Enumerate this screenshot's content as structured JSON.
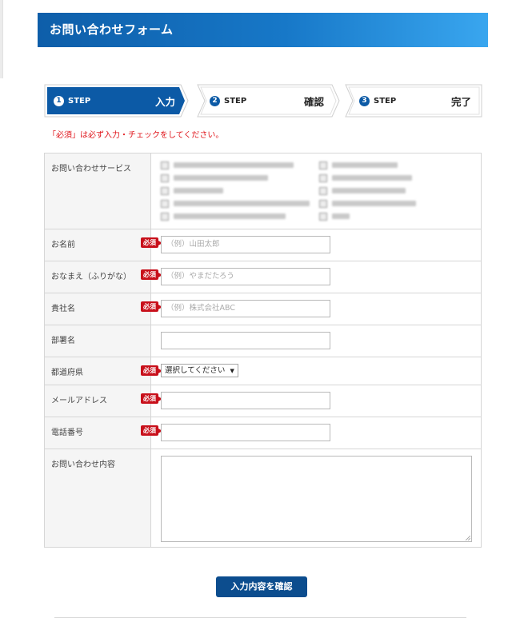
{
  "header": {
    "title": "お問い合わせフォーム"
  },
  "steps": [
    {
      "number": "1",
      "label": "STEP",
      "title": "入力",
      "active": true
    },
    {
      "number": "2",
      "label": "STEP",
      "title": "確認",
      "active": false
    },
    {
      "number": "3",
      "label": "STEP",
      "title": "完了",
      "active": false
    }
  ],
  "notice": "「必須」は必ず入力・チェックをしてください。",
  "required_badge": "必須",
  "form": {
    "services_label": "お問い合わせサービス",
    "name_label": "お名前",
    "name_placeholder": "（例）山田太郎",
    "kana_label": "おなまえ（ふりがな）",
    "kana_placeholder": "（例）やまだたろう",
    "company_label": "貴社名",
    "company_placeholder": "（例）株式会社ABC",
    "department_label": "部署名",
    "prefecture_label": "都道府県",
    "prefecture_selected": "選択してください",
    "email_label": "メールアドレス",
    "phone_label": "電話番号",
    "message_label": "お問い合わせ内容"
  },
  "confirm_button": "入力内容を確認",
  "colors": {
    "brand": "#0c5aa6",
    "required": "#c8101b",
    "notice": "#e0151b"
  }
}
